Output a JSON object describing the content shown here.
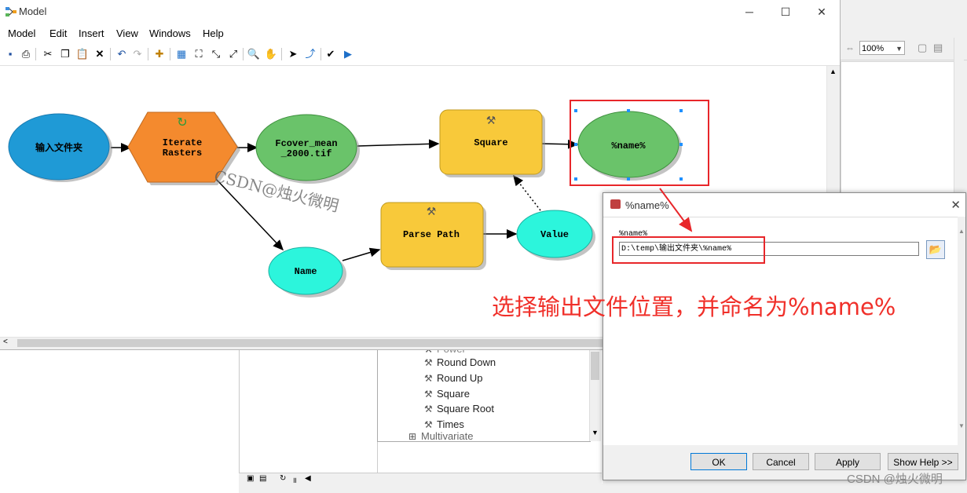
{
  "window": {
    "title": "Model",
    "icon": "model-icon"
  },
  "menu": [
    "Model",
    "Edit",
    "Insert",
    "View",
    "Windows",
    "Help"
  ],
  "nodes": {
    "input_folder": "输入文件夹",
    "iterate_line1": "Iterate",
    "iterate_line2": "Rasters",
    "raster_line1": "Fcover_mean",
    "raster_line2": "_2000.tif",
    "square": "Square",
    "output": "%name%",
    "name": "Name",
    "parse_path": "Parse Path",
    "value": "Value"
  },
  "watermark": "CSDN@烛火微明",
  "footer_watermark": "CSDN @烛火微明",
  "bg_app": {
    "zoom": "100%",
    "tools": [
      "Power",
      "Round Down",
      "Round Up",
      "Square",
      "Square Root",
      "Times",
      "Multivariate"
    ]
  },
  "dialog": {
    "title": "%name%",
    "field_label": "%name%",
    "field_value": "D:\\temp\\输出文件夹\\%name%",
    "buttons": {
      "ok": "OK",
      "cancel": "Cancel",
      "apply": "Apply",
      "help": "Show Help >>"
    }
  },
  "annotation": "选择输出文件位置，并命名为%name%",
  "colors": {
    "input": "#1f9ad6",
    "tool": "#f8c93a",
    "iterator": "#f48a2e",
    "derived": "#6ac36a",
    "variable": "#2cf5dc",
    "annotation": "#f0302a"
  }
}
